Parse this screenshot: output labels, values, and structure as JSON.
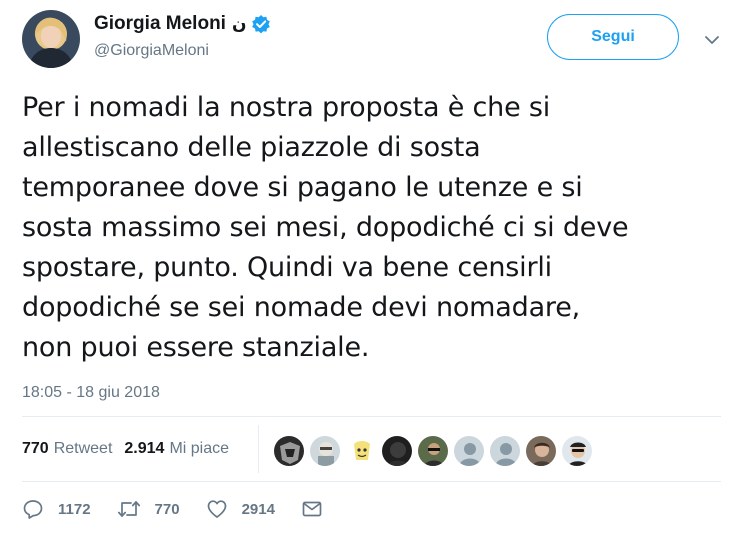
{
  "author": {
    "display_name": "Giorgia Meloni",
    "name_suffix": "ن",
    "handle": "@GiorgiaMeloni",
    "verified": true
  },
  "follow_button_label": "Segui",
  "tweet_text": "Per i nomadi la nostra proposta è che si\nallestiscano delle piazzole di sosta\ntemporanee dove si pagano le utenze e si\nsosta massimo sei mesi, dopodiché ci si deve\nspostare, punto. Quindi va bene censirli\ndopodiché se sei nomade devi nomadare,\nnon puoi essere stanziale.",
  "timestamp": "18:05 - 18 giu 2018",
  "stats": {
    "retweets_count": "770",
    "retweets_label": "Retweet",
    "likes_count": "2.914",
    "likes_label": "Mi piace"
  },
  "actions": {
    "reply_count": "1172",
    "retweet_count": "770",
    "like_count": "2914"
  },
  "colors": {
    "accent": "#1da1f2",
    "secondary_text": "#657786",
    "primary_text": "#14171a",
    "divider": "#e6ecf0"
  },
  "icons": [
    "verified-badge-icon",
    "chevron-down-icon",
    "reply-icon",
    "retweet-icon",
    "like-icon",
    "direct-message-icon"
  ]
}
